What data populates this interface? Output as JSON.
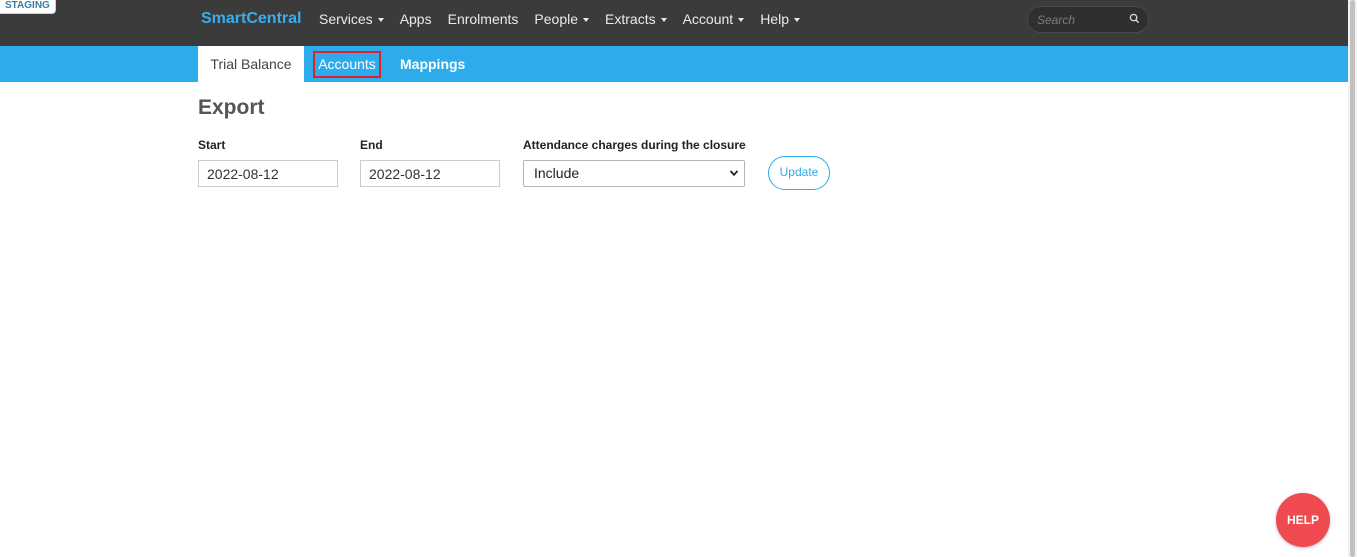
{
  "staging_badge": "STAGING",
  "topnav": {
    "brand": "SmartCentral",
    "menu": [
      {
        "label": "Services",
        "dropdown": true
      },
      {
        "label": "Apps",
        "dropdown": false
      },
      {
        "label": "Enrolments",
        "dropdown": false
      },
      {
        "label": "People",
        "dropdown": true
      },
      {
        "label": "Extracts",
        "dropdown": true
      },
      {
        "label": "Account",
        "dropdown": true
      },
      {
        "label": "Help",
        "dropdown": true
      }
    ],
    "search": {
      "placeholder": "Search",
      "icon": "search-icon"
    }
  },
  "subnav": {
    "tabs": [
      {
        "label": "Trial Balance",
        "active": true
      },
      {
        "label": "Accounts",
        "active": false,
        "highlighted": true
      },
      {
        "label": "Mappings",
        "active": false
      }
    ]
  },
  "main": {
    "title": "Export",
    "start": {
      "label": "Start",
      "value": "2022-08-12"
    },
    "end": {
      "label": "End",
      "value": "2022-08-12"
    },
    "attendance": {
      "label": "Attendance charges during the closure",
      "selected": "Include"
    },
    "update_label": "Update"
  },
  "help_button": "HELP",
  "colors": {
    "topnav_bg": "#3b3b3b",
    "brand": "#3aaeea",
    "subnav_bg": "#2eabeb",
    "highlight_border": "#e0202a",
    "help_button": "#ef4a4f"
  }
}
